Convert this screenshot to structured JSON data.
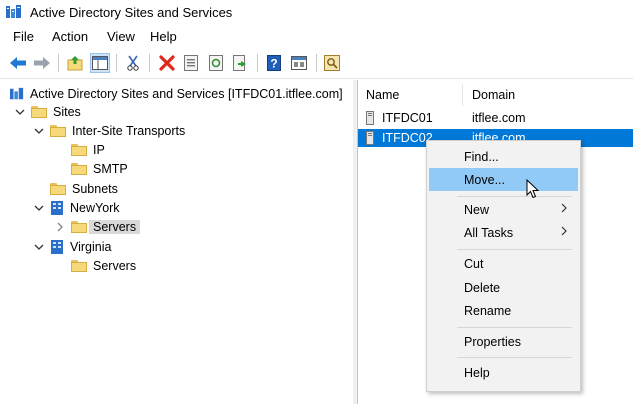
{
  "window": {
    "title": "Active Directory Sites and Services"
  },
  "menu": {
    "items": [
      "File",
      "Action",
      "View",
      "Help"
    ]
  },
  "toolbar": {
    "icons": [
      "back-icon",
      "forward-icon",
      "up-folder-icon",
      "show-hide-console-tree-icon",
      "cut-icon",
      "delete-icon",
      "properties-icon",
      "refresh-icon",
      "export-list-icon",
      "help-icon",
      "help-topics-icon",
      "new-object-icon"
    ]
  },
  "tree": {
    "root": "Active Directory Sites and Services [ITFDC01.itflee.com]",
    "sites": "Sites",
    "inter_site_transports": "Inter-Site Transports",
    "ip": "IP",
    "smtp": "SMTP",
    "subnets": "Subnets",
    "newyork": "NewYork",
    "newyork_servers": "Servers",
    "virginia": "Virginia",
    "virginia_servers": "Servers"
  },
  "list": {
    "columns": [
      "Name",
      "Domain"
    ],
    "rows": [
      {
        "name": "ITFDC01",
        "domain": "itflee.com"
      },
      {
        "name": "ITFDC02",
        "domain": "itflee.com"
      }
    ]
  },
  "context_menu": {
    "find": "Find...",
    "move": "Move...",
    "new": "New",
    "all_tasks": "All Tasks",
    "cut": "Cut",
    "delete": "Delete",
    "rename": "Rename",
    "properties": "Properties",
    "help": "Help"
  },
  "colors": {
    "selection": "#0078d7",
    "menu_highlight": "#91c9f7",
    "folder": "#f5d97b"
  }
}
